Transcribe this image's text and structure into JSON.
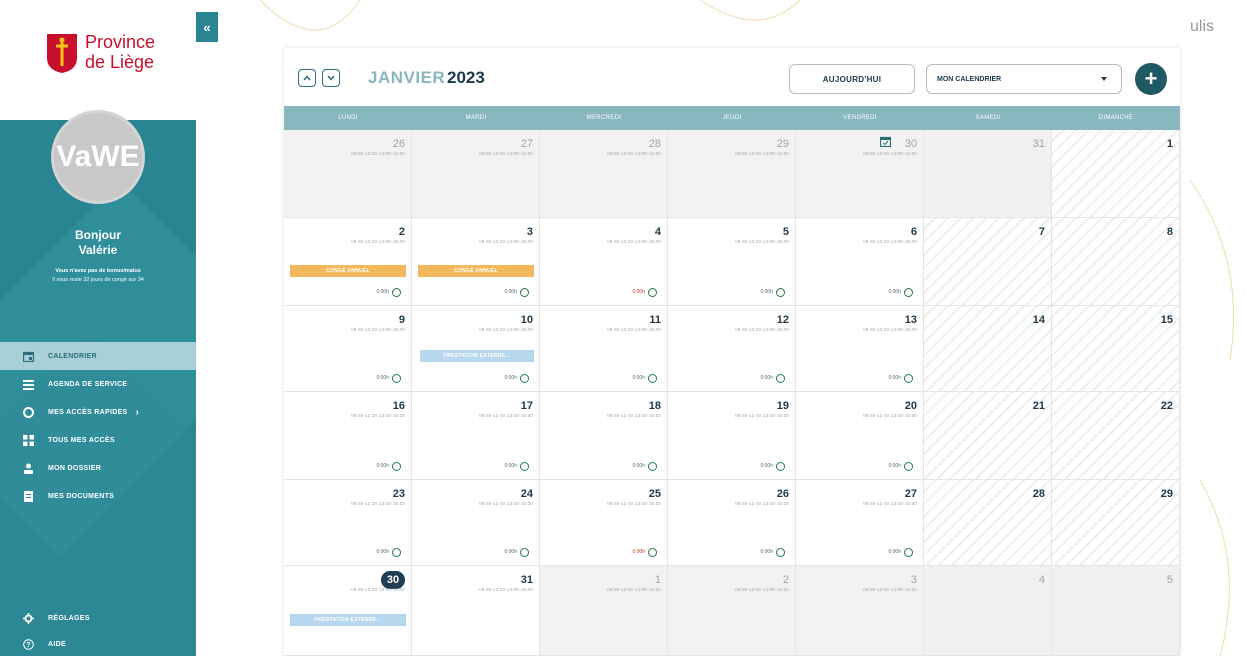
{
  "brand": {
    "logo_line1": "Province",
    "logo_line2": "de Liège",
    "app_name": "ulis"
  },
  "colors": {
    "sidebar": "#2a8592",
    "header_row": "#88b7bf",
    "accent_dark": "#1f3d55",
    "conge": "#f1b85c",
    "prestation": "#b7d8ef"
  },
  "user": {
    "avatar_initials": "VaWE",
    "greeting": "Bonjour",
    "name": "Valérie",
    "note_line1": "Vous n'avez pas de bonus/malus",
    "note_line2": "Il vous reste 32 jours de congé sur 34"
  },
  "sidebar": {
    "collapse_label": "«",
    "items": [
      {
        "label": "CALENDRIER",
        "icon": "calendar-icon",
        "active": true
      },
      {
        "label": "AGENDA DE SERVICE",
        "icon": "agenda-icon"
      },
      {
        "label": "MES ACCÈS RAPIDES",
        "icon": "quick-access-icon",
        "chevron": "›"
      },
      {
        "label": "TOUS MES ACCÈS",
        "icon": "grid-icon"
      },
      {
        "label": "MON DOSSIER",
        "icon": "user-icon"
      },
      {
        "label": "MES DOCUMENTS",
        "icon": "document-icon"
      }
    ],
    "bottom_items": [
      {
        "label": "RÉGLAGES",
        "icon": "gear-icon"
      },
      {
        "label": "AIDE",
        "icon": "help-icon"
      }
    ]
  },
  "calendar": {
    "month": "JANVIER",
    "year": "2023",
    "today_button": "AUJOURD'HUI",
    "calendar_select": "MON CALENDRIER",
    "add_button": "+",
    "weekdays": [
      "LUNDI",
      "MARDI",
      "MERCREDI",
      "JEUDI",
      "VENDREDI",
      "SAMEDI",
      "DIMANCHE"
    ],
    "weeks": [
      [
        {
          "day": "26",
          "out": true,
          "hours": "08:00-12:30 13:00-16:00"
        },
        {
          "day": "27",
          "out": true,
          "hours": "08:00-12:00 13:00-16:00"
        },
        {
          "day": "28",
          "out": true,
          "hours": "08:00-12:00 13:00-16:00"
        },
        {
          "day": "29",
          "out": true,
          "hours": "08:00-12:00 13:00-16:00"
        },
        {
          "day": "30",
          "out": true,
          "hours": "08:00-12:00 13:00-16:00",
          "cal_icon": true
        },
        {
          "day": "31",
          "out": true,
          "weekend": true
        },
        {
          "day": "1",
          "weekend": true
        }
      ],
      [
        {
          "day": "2",
          "hours": "08:00-12:30 13:00-16:00",
          "event": "CONGÉ ANNUEL",
          "event_type": "conge",
          "balance": "0:00h"
        },
        {
          "day": "3",
          "hours": "08:00-12:00 13:00-16:00",
          "event": "CONGÉ ANNUEL",
          "event_type": "conge",
          "balance": "0:00h"
        },
        {
          "day": "4",
          "hours": "08:00-12:00 13:00-16:00",
          "balance": "0:00h",
          "neg": true
        },
        {
          "day": "5",
          "hours": "08:00-12:00 13:00-16:00",
          "balance": "0:00h"
        },
        {
          "day": "6",
          "hours": "08:00-12:00 13:00-16:00",
          "balance": "0:00h"
        },
        {
          "day": "7",
          "weekend": true
        },
        {
          "day": "8",
          "weekend": true
        }
      ],
      [
        {
          "day": "9",
          "hours": "08:00-12:30 13:00-16:00",
          "balance": "0:00h"
        },
        {
          "day": "10",
          "hours": "08:00-12:00 13:00-16:00",
          "event": "PRESTATION EXTERNE...",
          "event_type": "presta",
          "balance": "0:00h"
        },
        {
          "day": "11",
          "hours": "08:00-12:00 13:00-16:00",
          "balance": "0:00h"
        },
        {
          "day": "12",
          "hours": "08:00-12:00 13:00-16:00",
          "balance": "0:00h"
        },
        {
          "day": "13",
          "hours": "08:00-12:00 13:00-16:00",
          "balance": "0:00h"
        },
        {
          "day": "14",
          "weekend": true
        },
        {
          "day": "15",
          "weekend": true
        }
      ],
      [
        {
          "day": "16",
          "hours": "08:00-12:30 13:00-16:00",
          "balance": "0:00h"
        },
        {
          "day": "17",
          "hours": "08:00-12:00 13:00-16:00",
          "balance": "0:00h"
        },
        {
          "day": "18",
          "hours": "08:00-12:00 13:00-16:00",
          "balance": "0:00h"
        },
        {
          "day": "19",
          "hours": "08:00-12:00 13:00-16:00",
          "balance": "0:00h"
        },
        {
          "day": "20",
          "hours": "08:00-12:00 13:00-16:00",
          "balance": "0:00h"
        },
        {
          "day": "21",
          "weekend": true
        },
        {
          "day": "22",
          "weekend": true
        }
      ],
      [
        {
          "day": "23",
          "hours": "08:00-12:30 13:00-16:00",
          "balance": "0:00h"
        },
        {
          "day": "24",
          "hours": "08:00-12:00 13:00-16:00",
          "balance": "0:00h"
        },
        {
          "day": "25",
          "hours": "08:00-12:00 13:00-16:00",
          "balance": "0:00h",
          "neg": true
        },
        {
          "day": "26",
          "hours": "08:00-12:00 13:00-16:00",
          "balance": "0:00h"
        },
        {
          "day": "27",
          "hours": "08:00-12:00 13:00-16:00",
          "balance": "0:00h"
        },
        {
          "day": "28",
          "weekend": true
        },
        {
          "day": "29",
          "weekend": true
        }
      ],
      [
        {
          "day": "30",
          "today": true,
          "hours": "08:00-12:30 13:00-16:00",
          "event": "PRESTATION EXTERNE...",
          "event_type": "presta2"
        },
        {
          "day": "31",
          "hours": "08:00-12:00 13:00-16:00"
        },
        {
          "day": "1",
          "out": true,
          "hours": "08:00-12:00 13:00-16:00"
        },
        {
          "day": "2",
          "out": true,
          "hours": "08:00-12:00 13:00-16:00"
        },
        {
          "day": "3",
          "out": true,
          "hours": "08:00-12:00 13:00-16:00"
        },
        {
          "day": "4",
          "out": true,
          "weekend": true
        },
        {
          "day": "5",
          "out": true,
          "weekend": true
        }
      ]
    ]
  }
}
